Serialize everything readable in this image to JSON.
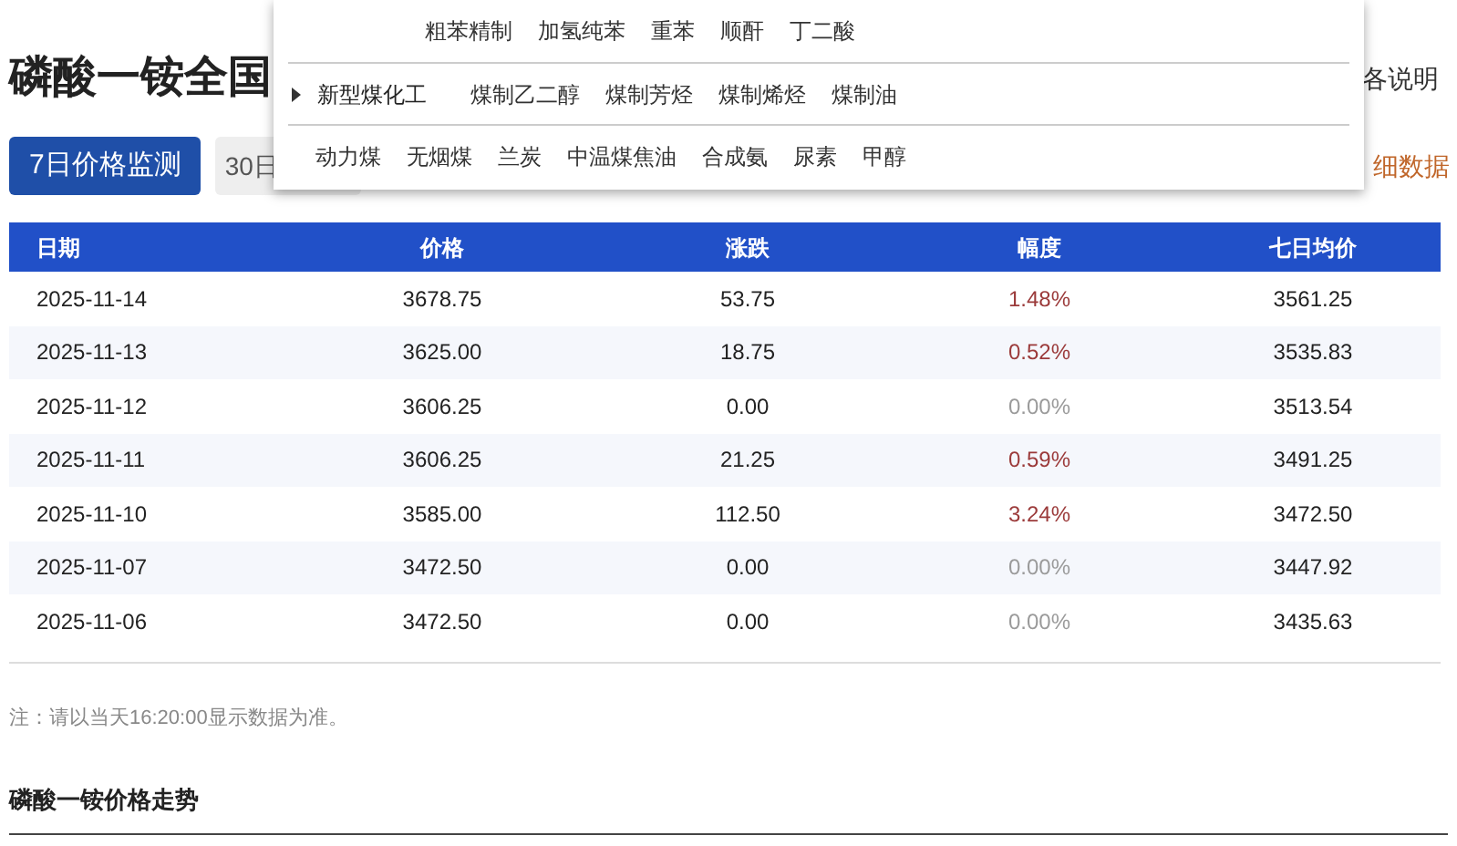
{
  "title": "磷酸一铵全国",
  "header_link": "各说明",
  "tabs": [
    {
      "label": "7日价格监测",
      "selected": true
    },
    {
      "label": "30日",
      "selected": false
    }
  ],
  "detail_link": "细数据",
  "dropdown": {
    "rows": [
      {
        "category": "",
        "items": [
          "粗苯精制",
          "加氢纯苯",
          "重苯",
          "顺酐",
          "丁二酸"
        ]
      },
      {
        "category": "新型煤化工",
        "items": [
          "煤制乙二醇",
          "煤制芳烃",
          "煤制烯烃",
          "煤制油"
        ]
      },
      {
        "category": "",
        "items": [
          "动力煤",
          "无烟煤",
          "兰炭",
          "中温煤焦油",
          "合成氨",
          "尿素",
          "甲醇"
        ]
      }
    ]
  },
  "table": {
    "columns": [
      "日期",
      "价格",
      "涨跌",
      "幅度",
      "七日均价"
    ],
    "rows": [
      {
        "date": "2025-11-14",
        "price": "3678.75",
        "change": "53.75",
        "pct": "1.48%",
        "color": "#9b3a3a",
        "avg": "3561.25"
      },
      {
        "date": "2025-11-13",
        "price": "3625.00",
        "change": "18.75",
        "pct": "0.52%",
        "color": "#9b3a3a",
        "avg": "3535.83"
      },
      {
        "date": "2025-11-12",
        "price": "3606.25",
        "change": "0.00",
        "pct": "0.00%",
        "color": "#9a9a9a",
        "avg": "3513.54"
      },
      {
        "date": "2025-11-11",
        "price": "3606.25",
        "change": "21.25",
        "pct": "0.59%",
        "color": "#9b3a3a",
        "avg": "3491.25"
      },
      {
        "date": "2025-11-10",
        "price": "3585.00",
        "change": "112.50",
        "pct": "3.24%",
        "color": "#9b3a3a",
        "avg": "3472.50"
      },
      {
        "date": "2025-11-07",
        "price": "3472.50",
        "change": "0.00",
        "pct": "0.00%",
        "color": "#9a9a9a",
        "avg": "3447.92"
      },
      {
        "date": "2025-11-06",
        "price": "3472.50",
        "change": "0.00",
        "pct": "0.00%",
        "color": "#9a9a9a",
        "avg": "3435.63"
      }
    ]
  },
  "note": "注：请以当天16:20:00显示数据为准。",
  "section_title": "磷酸一铵价格走势"
}
